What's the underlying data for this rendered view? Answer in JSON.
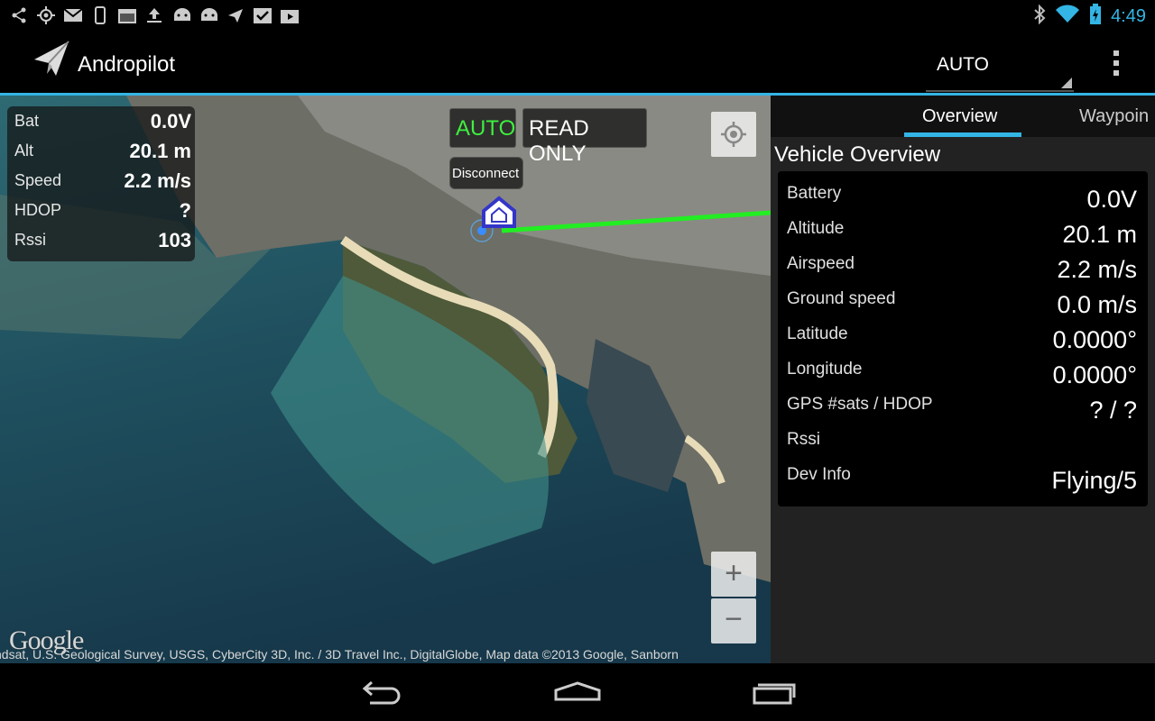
{
  "status_bar": {
    "left_icons": [
      "share-icon",
      "gps-icon",
      "gmail-icon",
      "phone-icon",
      "calendar-icon",
      "upload-icon",
      "android-icon",
      "android-icon",
      "send-icon",
      "checklist-icon",
      "play-store-icon"
    ],
    "time": "4:49"
  },
  "action_bar": {
    "app_title": "Andropilot",
    "mode_spinner": "AUTO"
  },
  "map": {
    "telemetry": [
      {
        "label": "Bat",
        "value": "0.0V"
      },
      {
        "label": "Alt",
        "value": "20.1 m"
      },
      {
        "label": "Speed",
        "value": "2.2 m/s"
      },
      {
        "label": "HDOP",
        "value": "?"
      },
      {
        "label": "Rssi",
        "value": "103"
      }
    ],
    "mode_button": "AUTO",
    "read_only_button": "READ ONLY",
    "disconnect_button": "Disconnect",
    "zoom_in": "+",
    "zoom_out": "−",
    "google_logo": "Google",
    "attribution": "ndsat, U.S. Geological Survey, USGS, CyberCity 3D, Inc. / 3D Travel Inc., DigitalGlobe, Map data ©2013 Google, Sanborn",
    "colors": {
      "flight_path": "#22ee22",
      "mode_active": "#3ef03e"
    }
  },
  "panel": {
    "tabs": [
      {
        "label": "Overview",
        "selected": true
      },
      {
        "label": "Waypoin",
        "selected": false
      }
    ],
    "title": "Vehicle Overview",
    "rows": [
      {
        "label": "Battery",
        "value": "0.0V"
      },
      {
        "label": "Altitude",
        "value": "20.1 m"
      },
      {
        "label": "Airspeed",
        "value": "2.2 m/s"
      },
      {
        "label": "Ground speed",
        "value": "0.0 m/s"
      },
      {
        "label": "Latitude",
        "value": "0.0000°"
      },
      {
        "label": "Longitude",
        "value": "0.0000°"
      },
      {
        "label": "GPS #sats / HDOP",
        "value": "? / ?"
      },
      {
        "label": "Rssi",
        "value": ""
      },
      {
        "label": "Dev Info",
        "value": "Flying/5"
      }
    ]
  },
  "nav_bar": {
    "buttons": [
      "back-icon",
      "home-icon",
      "recent-apps-icon"
    ]
  },
  "theme": {
    "accent": "#33b5e5"
  }
}
